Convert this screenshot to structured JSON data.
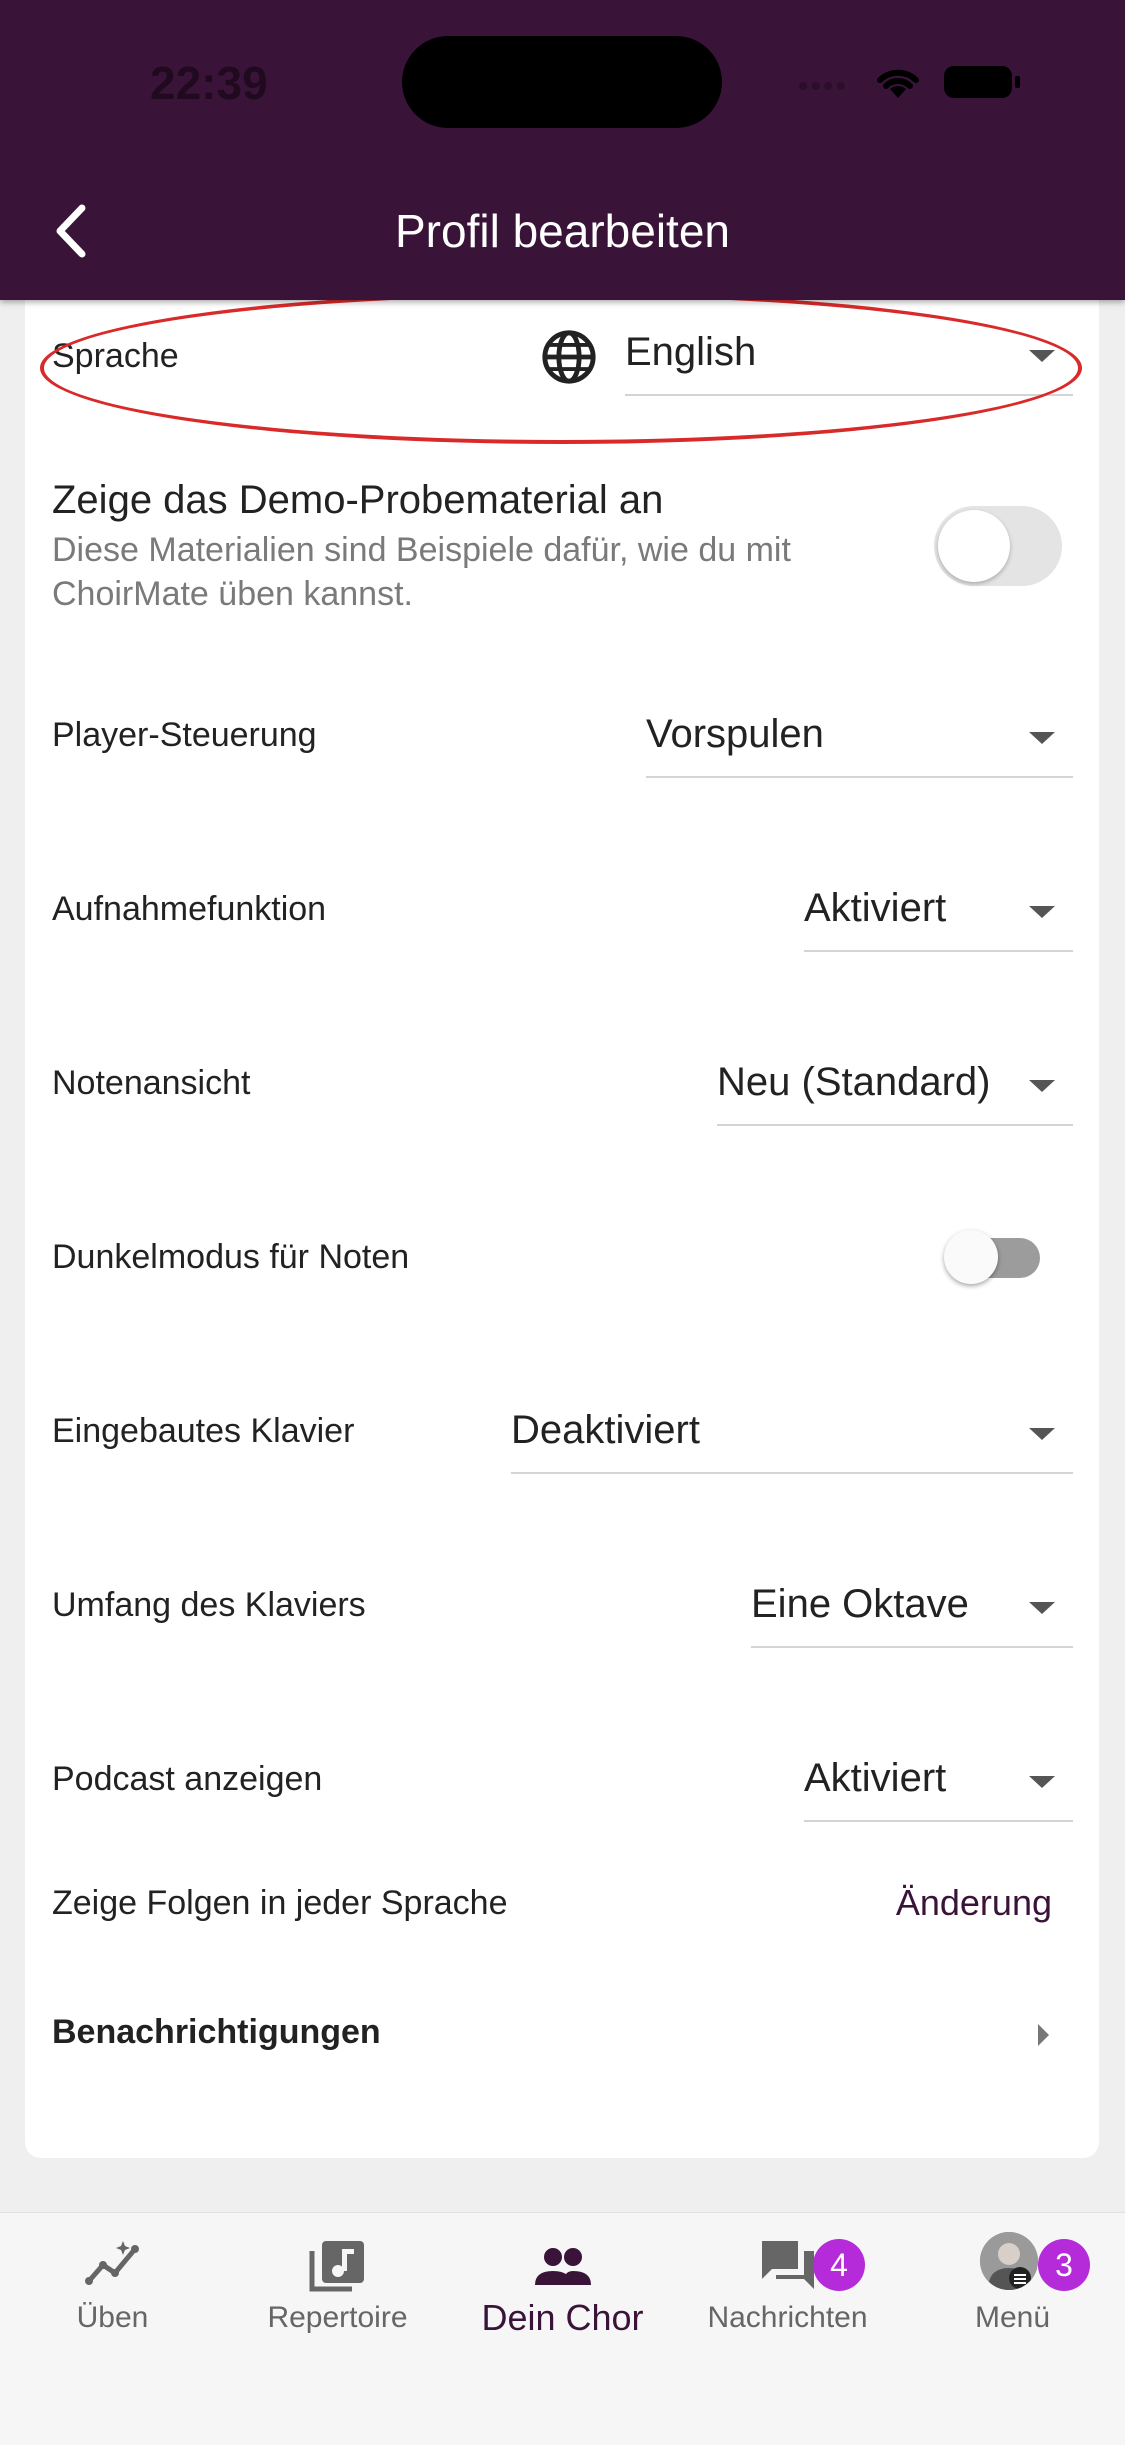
{
  "status_bar": {
    "time": "22:39",
    "dots": "••••"
  },
  "header": {
    "title": "Profil bearbeiten"
  },
  "settings": {
    "language": {
      "label": "Sprache",
      "value": "English"
    },
    "demo": {
      "title": "Zeige das Demo-Probematerial an",
      "description": "Diese Materialien sind Beispiele dafür, wie du mit ChoirMate üben kannst.",
      "enabled": false
    },
    "player_control": {
      "label": "Player-Steuerung",
      "value": "Vorspulen"
    },
    "recording": {
      "label": "Aufnahmefunktion",
      "value": "Aktiviert"
    },
    "score_view": {
      "label": "Notenansicht",
      "value": "Neu (Standard)"
    },
    "dark_mode": {
      "label": "Dunkelmodus für Noten",
      "enabled": false
    },
    "piano": {
      "label": "Eingebautes Klavier",
      "value": "Deaktiviert"
    },
    "piano_range": {
      "label": "Umfang des Klaviers",
      "value": "Eine Oktave"
    },
    "podcast": {
      "label": "Podcast anzeigen",
      "value": "Aktiviert"
    },
    "episodes": {
      "label": "Zeige Folgen in jeder Sprache",
      "action": "Änderung"
    },
    "notifications": {
      "label": "Benachrichtigungen"
    }
  },
  "bottom_nav": {
    "items": [
      {
        "label": "Üben",
        "icon": "practice-icon"
      },
      {
        "label": "Repertoire",
        "icon": "music-note-icon"
      },
      {
        "label": "Dein Chor",
        "icon": "group-icon",
        "active": true
      },
      {
        "label": "Nachrichten",
        "icon": "chat-icon",
        "badge": "4"
      },
      {
        "label": "Menü",
        "icon": "avatar-icon",
        "badge": "3"
      }
    ]
  },
  "colors": {
    "primary": "#3a1339",
    "badge": "#b52bd9",
    "highlight": "#d92a2a"
  }
}
